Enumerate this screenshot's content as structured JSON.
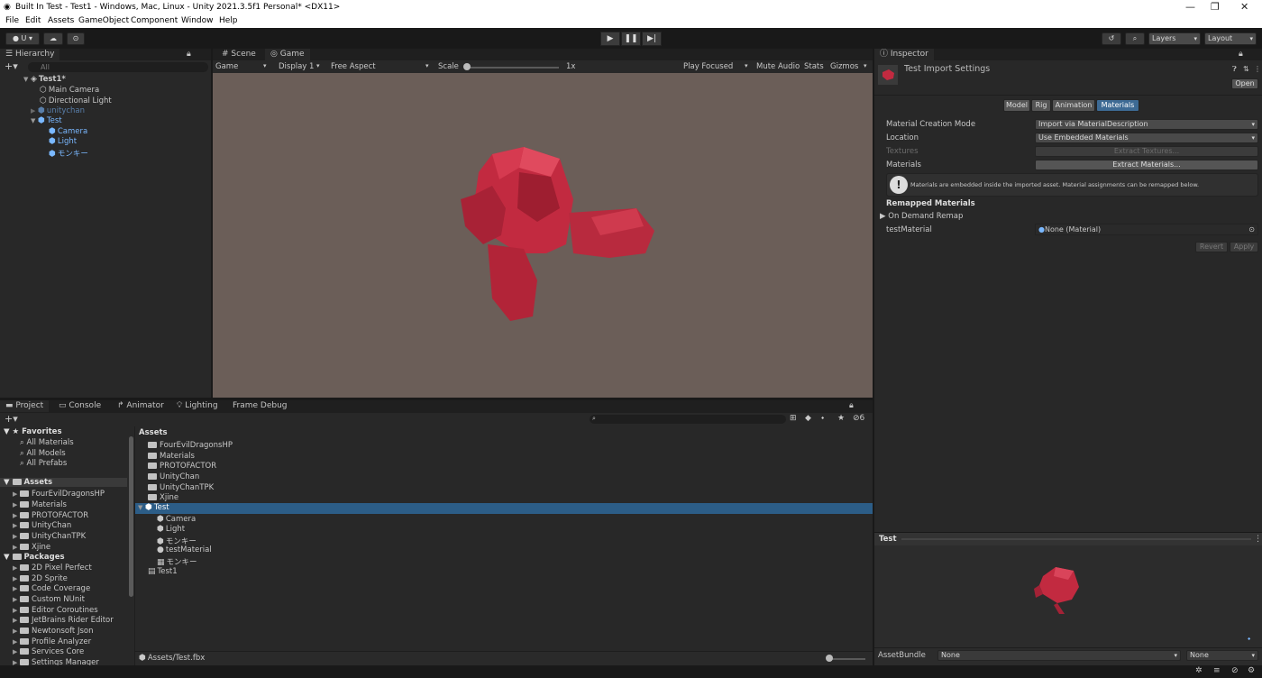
{
  "window": {
    "title": "Built In Test - Test1 - Windows, Mac, Linux - Unity 2021.3.5f1 Personal* <DX11>",
    "minimize": "—",
    "maximize": "❐",
    "close": "✕"
  },
  "menu": [
    "File",
    "Edit",
    "Assets",
    "GameObject",
    "Component",
    "Window",
    "Help"
  ],
  "toolbar": {
    "account": "U",
    "layers": "Layers",
    "layout": "Layout"
  },
  "hierarchy": {
    "tab": "Hierarchy",
    "search_placeholder": "All",
    "scene": "Test1*",
    "items": [
      "Main Camera",
      "Directional Light",
      "unitychan",
      "Test",
      "Camera",
      "Light",
      "モンキー"
    ]
  },
  "scene_tabs": {
    "scene": "Scene",
    "game": "Game"
  },
  "game_bar": {
    "mode": "Game",
    "display": "Display 1",
    "aspect": "Free Aspect",
    "scale_label": "Scale",
    "scale_value": "1x",
    "play_focused": "Play Focused",
    "mute": "Mute Audio",
    "stats": "Stats",
    "gizmos": "Gizmos"
  },
  "project_tabs": [
    "Project",
    "Console",
    "Animator",
    "Lighting",
    "Frame Debug"
  ],
  "project": {
    "hidden_count": "6",
    "favorites_label": "Favorites",
    "favorites": [
      "All Materials",
      "All Models",
      "All Prefabs"
    ],
    "assets_label": "Assets",
    "assets": [
      "FourEvilDragonsHP",
      "Materials",
      "PROTOFACTOR",
      "UnityChan",
      "UnityChanTPK",
      "Xjine"
    ],
    "packages_label": "Packages",
    "packages": [
      "2D Pixel Perfect",
      "2D Sprite",
      "Code Coverage",
      "Custom NUnit",
      "Editor Coroutines",
      "JetBrains Rider Editor",
      "Newtonsoft Json",
      "Profile Analyzer",
      "Services Core",
      "Settings Manager"
    ],
    "content_header": "Assets",
    "content_folders": [
      "FourEvilDragonsHP",
      "Materials",
      "PROTOFACTOR",
      "UnityChan",
      "UnityChanTPK",
      "Xjine"
    ],
    "selected_item": "Test",
    "children": [
      "Camera",
      "Light",
      "モンキー",
      "testMaterial",
      "モンキー"
    ],
    "scene_file": "Test1",
    "path": "Assets/Test.fbx"
  },
  "inspector": {
    "tab": "Inspector",
    "title": "Test Import Settings",
    "open": "Open",
    "tabs": [
      "Model",
      "Rig",
      "Animation",
      "Materials"
    ],
    "fields": [
      {
        "label": "Material Creation Mode",
        "value": "Import via MaterialDescription"
      },
      {
        "label": "Location",
        "value": "Use Embedded Materials"
      }
    ],
    "textures_label": "Textures",
    "extract_textures": "Extract Textures...",
    "materials_label": "Materials",
    "extract_materials": "Extract Materials...",
    "info": "Materials are embedded inside the imported asset. Material assignments can be remapped below.",
    "remapped_header": "Remapped Materials",
    "on_demand": "On Demand Remap",
    "material_slot_label": "testMaterial",
    "material_slot_value": "None (Material)",
    "revert": "Revert",
    "apply": "Apply"
  },
  "preview": {
    "title": "Test",
    "assetbundle_label": "AssetBundle",
    "assetbundle_value": "None",
    "variant_value": "None"
  },
  "colors": {
    "accent": "#2c5d87",
    "monkey": "#c22a40",
    "game_bg": "#6b5e58"
  }
}
